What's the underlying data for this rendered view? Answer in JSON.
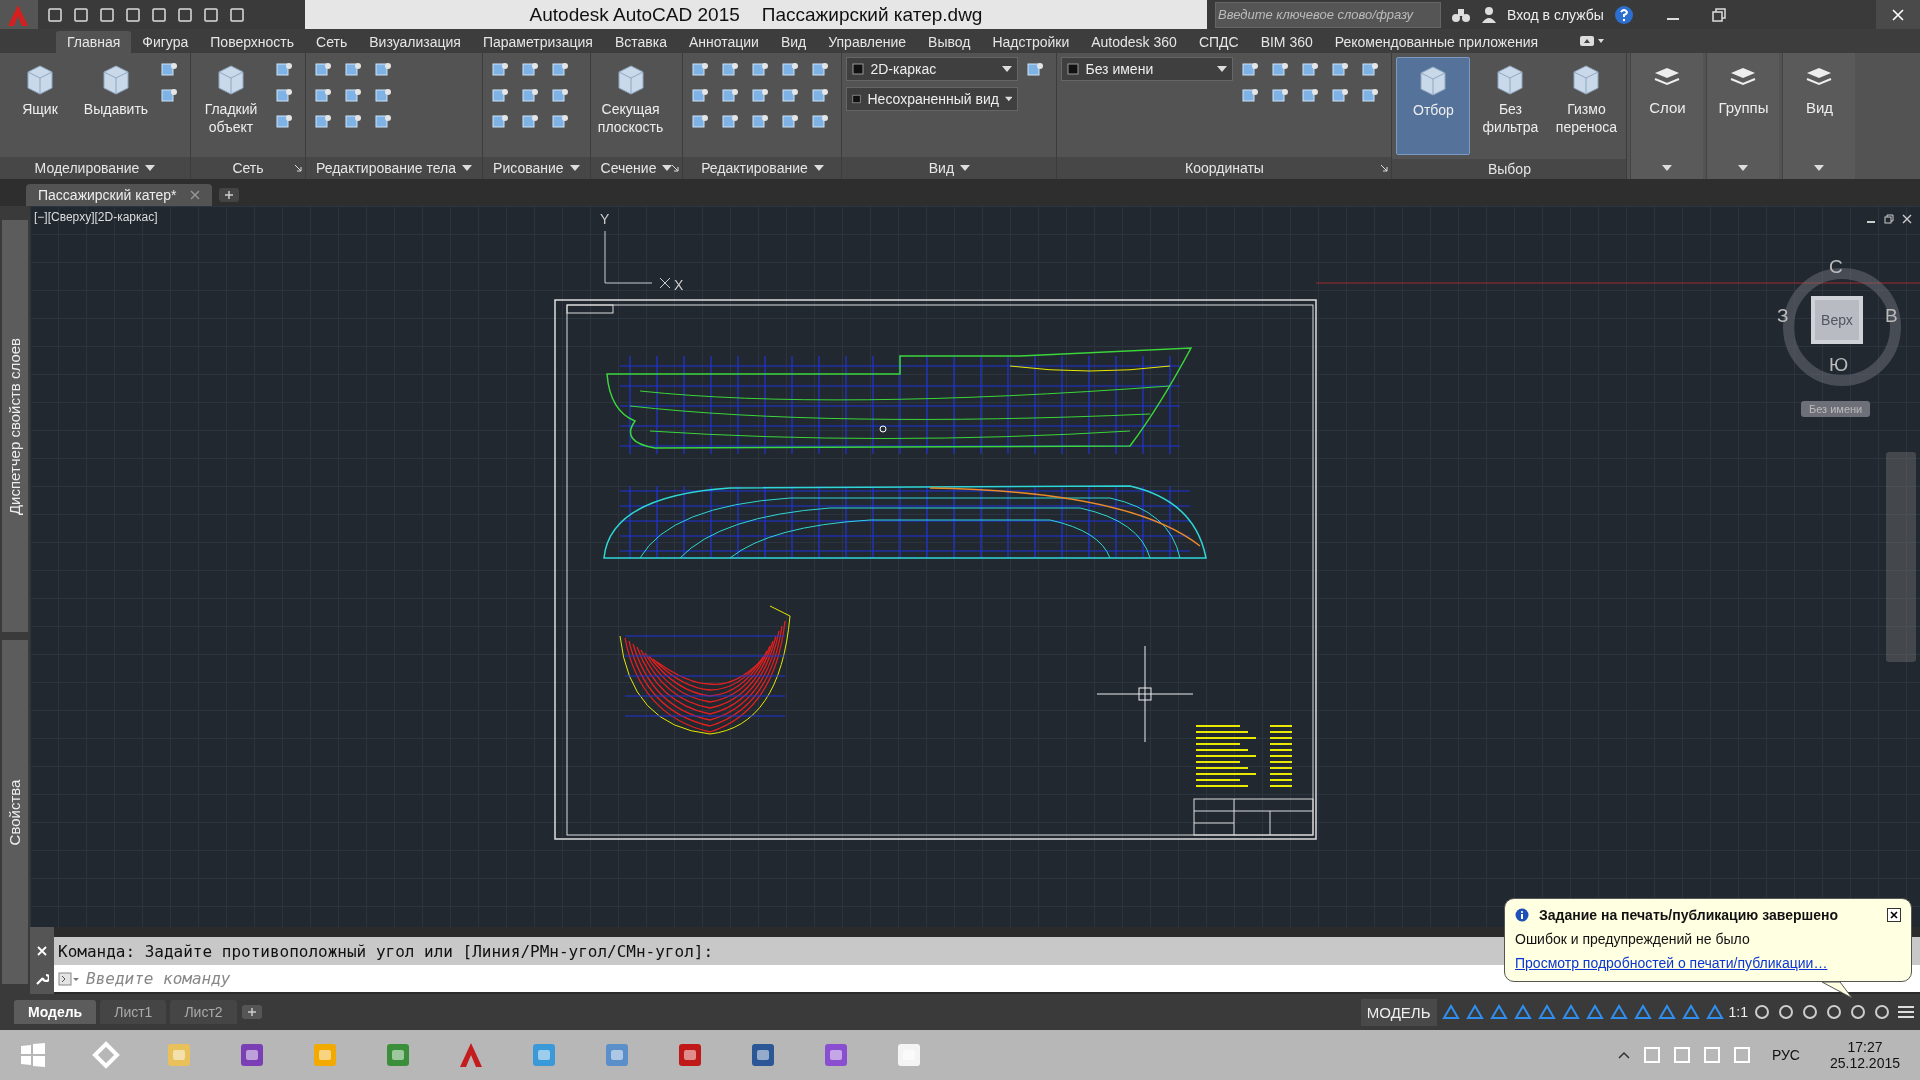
{
  "title_bar": {
    "app": "Autodesk AutoCAD 2015",
    "file": "Пассажирский катер.dwg",
    "search_placeholder": "Введите ключевое слово/фразу",
    "sign_in": "Вход в службы"
  },
  "ribbon_tabs": [
    {
      "label": "Главная",
      "selected": true
    },
    {
      "label": "Фигура",
      "selected": false
    },
    {
      "label": "Поверхность",
      "selected": false
    },
    {
      "label": "Сеть",
      "selected": false
    },
    {
      "label": "Визуализация",
      "selected": false
    },
    {
      "label": "Параметризация",
      "selected": false
    },
    {
      "label": "Вставка",
      "selected": false
    },
    {
      "label": "Аннотации",
      "selected": false
    },
    {
      "label": "Вид",
      "selected": false
    },
    {
      "label": "Управление",
      "selected": false
    },
    {
      "label": "Вывод",
      "selected": false
    },
    {
      "label": "Надстройки",
      "selected": false
    },
    {
      "label": "Autodesk 360",
      "selected": false
    },
    {
      "label": "СПДС",
      "selected": false
    },
    {
      "label": "BIM 360",
      "selected": false
    },
    {
      "label": "Рекомендованные приложения",
      "selected": false
    }
  ],
  "ribbon_panels": [
    {
      "title": "Моделирование",
      "menu": true,
      "launcher": false,
      "large": [
        {
          "label": "Ящик",
          "selected": false
        },
        {
          "label": "Выдавить",
          "selected": false
        }
      ]
    },
    {
      "title": "Сеть",
      "menu": false,
      "launcher": true,
      "large": [
        {
          "label": "Гладкий объект",
          "selected": false
        }
      ]
    },
    {
      "title": "Редактирование тела",
      "menu": true,
      "launcher": false
    },
    {
      "title": "Рисование",
      "menu": true,
      "launcher": false
    },
    {
      "title": "Сечение",
      "menu": true,
      "launcher": true,
      "large": [
        {
          "label": "Секущая плоскость",
          "selected": false
        }
      ]
    },
    {
      "title": "Редактирование",
      "menu": true,
      "launcher": false
    },
    {
      "title": "Вид",
      "menu": true,
      "launcher": false,
      "dropdowns": [
        "2D-каркас",
        "Несохраненный вид"
      ]
    },
    {
      "title": "Координаты",
      "menu": false,
      "launcher": true,
      "dropdowns": [
        "Без имени"
      ]
    },
    {
      "title": "Выбор",
      "menu": false,
      "launcher": false,
      "large": [
        {
          "label": "Отбор",
          "selected": true
        },
        {
          "label": "Без фильтра",
          "selected": false
        },
        {
          "label": "Гизмо переноса",
          "selected": false
        }
      ]
    }
  ],
  "side_panels": [
    {
      "label": "Слои"
    },
    {
      "label": "Группы"
    },
    {
      "label": "Вид"
    }
  ],
  "document_tabs": [
    {
      "label": "Пассажирский катер*",
      "selected": true
    }
  ],
  "palettes": [
    "Диспетчер свойств слоев",
    "Свойства"
  ],
  "viewport": {
    "label": "[−][Сверху][2D-каркас]",
    "ucs": {
      "y": "Y",
      "x": "X"
    },
    "viewcube": {
      "north": "С",
      "west": "З",
      "east": "В",
      "south": "Ю",
      "face": "Верх",
      "ucs_menu": "Без имени"
    }
  },
  "command_line": {
    "history": "Команда: Задайте противоположный угол или [Линия/РМн-угол/СМн-угол]:",
    "placeholder": "Введите команду"
  },
  "layout_tabs": [
    {
      "label": "Модель",
      "selected": true
    },
    {
      "label": "Лист1",
      "selected": false
    },
    {
      "label": "Лист2",
      "selected": false
    }
  ],
  "status_bar": {
    "space": "МОДЕЛЬ",
    "scale": "1:1"
  },
  "notification": {
    "title": "Задание на печать/публикацию завершено",
    "message": "Ошибок и предупреждений не было",
    "link": "Просмотр подробностей о печати/публикации…"
  },
  "taskbar": {
    "apps": [
      {
        "kind": "start"
      },
      {
        "kind": "switch"
      },
      {
        "kind": "folder"
      },
      {
        "kind": "player"
      },
      {
        "kind": "cone"
      },
      {
        "kind": "browser"
      },
      {
        "kind": "autocad"
      },
      {
        "kind": "plane"
      },
      {
        "kind": "calculator"
      },
      {
        "kind": "pdf"
      },
      {
        "kind": "word"
      },
      {
        "kind": "pen"
      },
      {
        "kind": "file"
      }
    ],
    "language": "РУС",
    "time": "17:27",
    "date": "25.12.2015"
  }
}
